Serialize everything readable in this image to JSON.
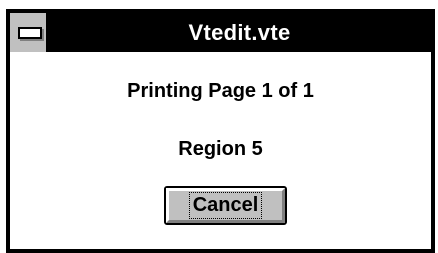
{
  "window": {
    "title": "Vtedit.vte",
    "system_menu_icon": "system-menu-icon"
  },
  "message": {
    "page_status": "Printing Page 1 of 1",
    "region_status": "Region 5"
  },
  "buttons": {
    "cancel_label": "Cancel"
  },
  "colors": {
    "title_bar": "#000000",
    "title_text": "#ffffff",
    "client_background": "#ffffff",
    "button_face": "#c0c0c0"
  }
}
